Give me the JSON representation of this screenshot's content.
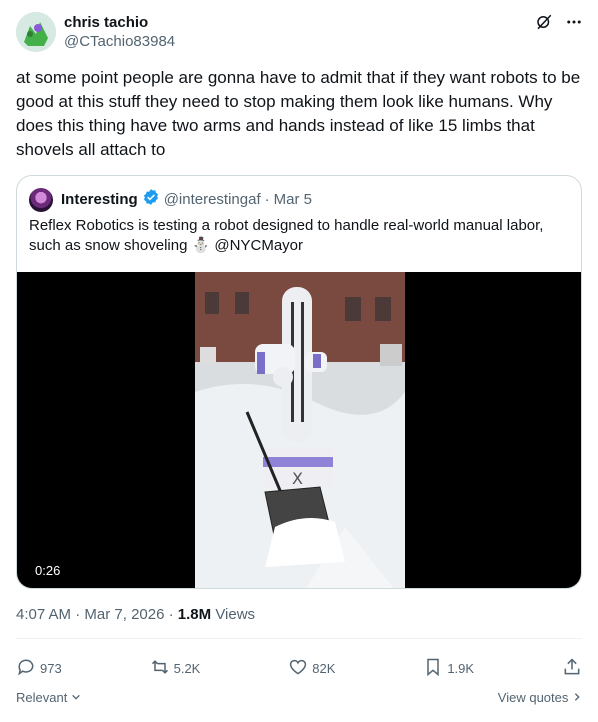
{
  "author": {
    "name": "chris tachio",
    "handle": "@CTachio83984"
  },
  "tweet": {
    "text": "at some point people are gonna have to admit that if they want robots to be good at this stuff they need to stop making them look like humans. Why does this thing have two arms and hands instead of like 15 limbs that shovels all attach to"
  },
  "quote": {
    "name": "Interesting",
    "handle": "@interestingaf",
    "date": "Mar 5",
    "separator": "·",
    "text": "Reflex Robotics is testing a robot designed to handle real-world manual labor, such as snow shoveling ⛄ @NYCMayor",
    "video_duration": "0:26"
  },
  "meta": {
    "time": "4:07 AM",
    "date": "Mar 7, 2026",
    "separator": "·",
    "views_count": "1.8M",
    "views_label": "Views"
  },
  "actions": {
    "replies": "973",
    "reposts": "5.2K",
    "likes": "82K",
    "bookmarks": "1.9K"
  },
  "footer": {
    "sort_label": "Relevant",
    "view_quotes_label": "View quotes"
  },
  "colors": {
    "verified_badge": "#1d9bf0",
    "secondary_text": "#536471",
    "primary_text": "#0f1419",
    "border": "#cfd9de"
  }
}
